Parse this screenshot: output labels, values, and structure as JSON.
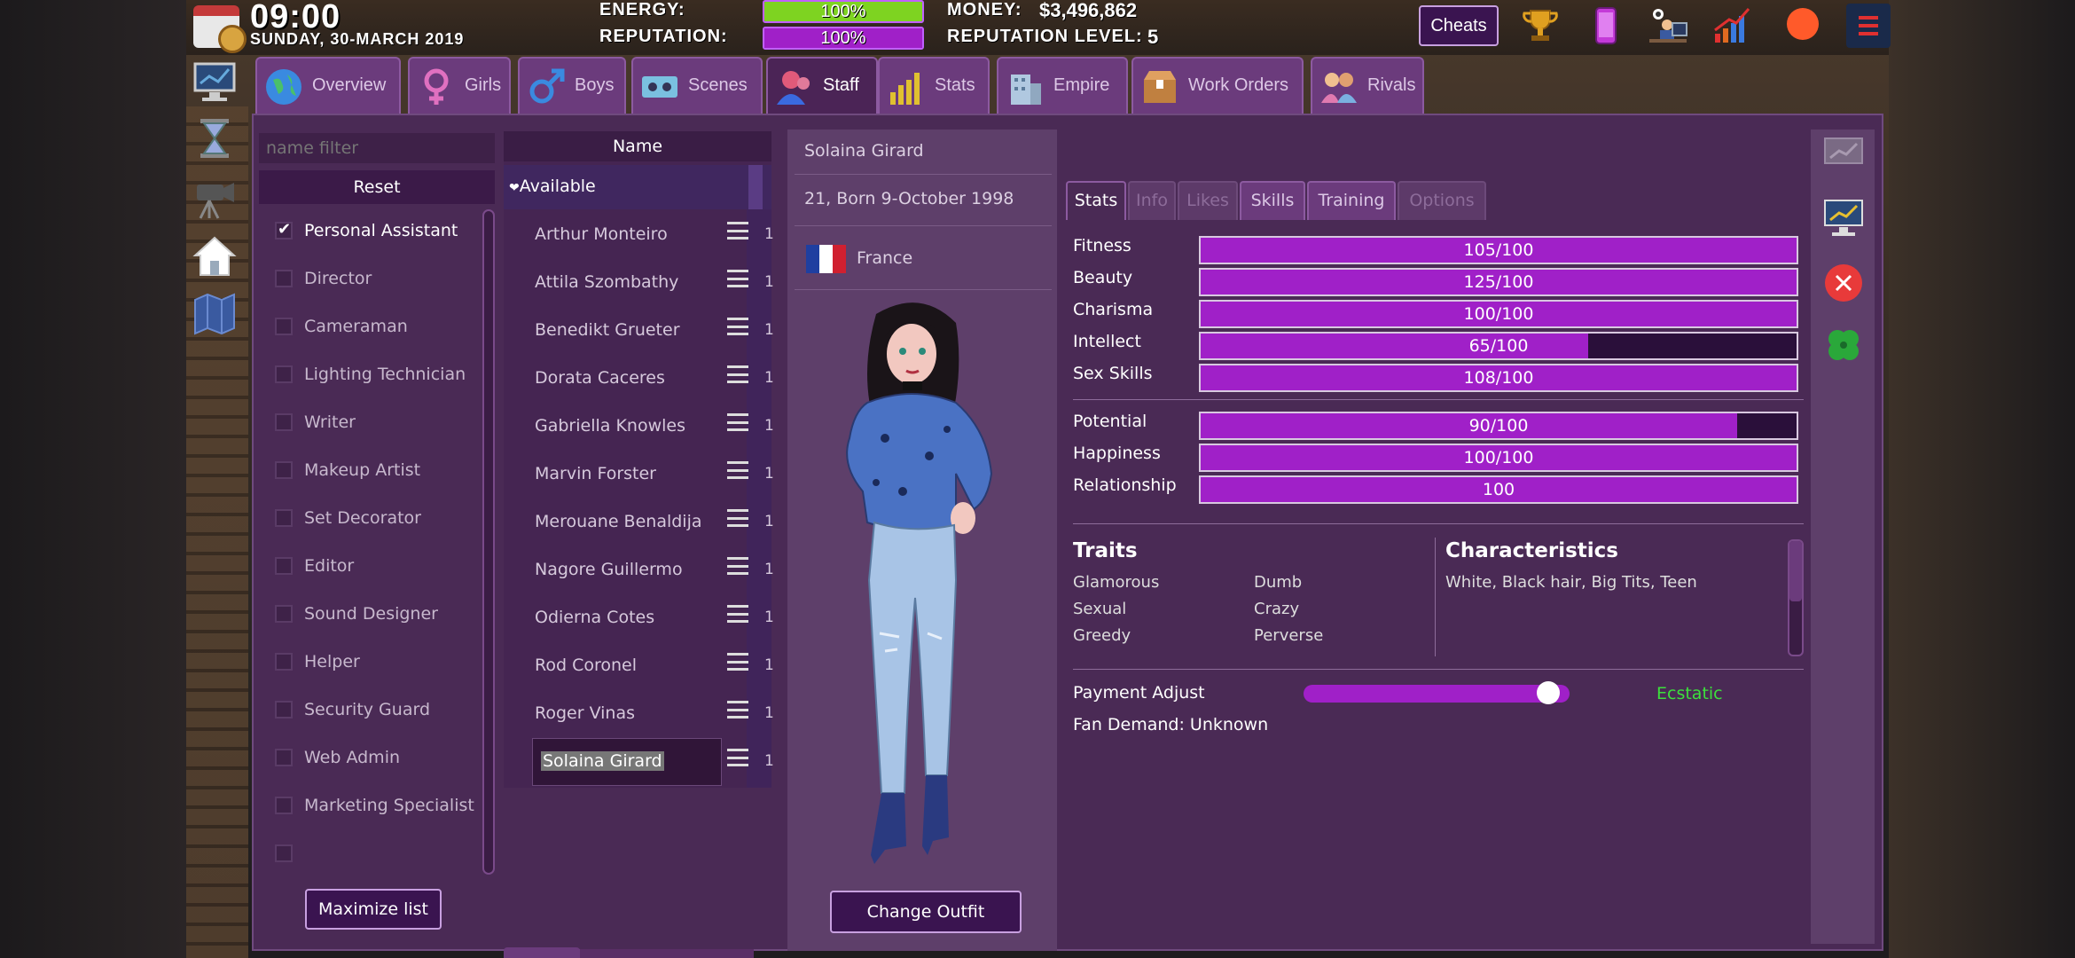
{
  "hud": {
    "time": "09:00",
    "date": "SUNDAY, 30-MARCH  2019",
    "energy_label": "ENERGY:",
    "energy_value": "100%",
    "energy_fraction": 1.0,
    "reputation_label": "REPUTATION:",
    "reputation_value": "100%",
    "money_label": "MONEY:",
    "money_value": "$3,496,862",
    "rep_level_label": "REPUTATION LEVEL:",
    "rep_level_value": "5",
    "cheats_label": "Cheats"
  },
  "tabs": [
    {
      "label": "Overview",
      "icon": "globe-icon"
    },
    {
      "label": "Girls",
      "icon": "female-icon"
    },
    {
      "label": "Boys",
      "icon": "male-icon"
    },
    {
      "label": "Scenes",
      "icon": "cassette-icon"
    },
    {
      "label": "Staff",
      "icon": "staff-icon",
      "active": true
    },
    {
      "label": "Stats",
      "icon": "bar-chart-icon"
    },
    {
      "label": "Empire",
      "icon": "building-icon"
    },
    {
      "label": "Work Orders",
      "icon": "box-icon"
    },
    {
      "label": "Rivals",
      "icon": "rivals-icon"
    }
  ],
  "filter": {
    "placeholder": "name filter",
    "reset_label": "Reset",
    "roles": [
      {
        "label": "Personal Assistant",
        "checked": true
      },
      {
        "label": "Director",
        "checked": false
      },
      {
        "label": "Cameraman",
        "checked": false
      },
      {
        "label": "Lighting Technician",
        "checked": false
      },
      {
        "label": "Writer",
        "checked": false
      },
      {
        "label": "Makeup Artist",
        "checked": false
      },
      {
        "label": "Set Decorator",
        "checked": false
      },
      {
        "label": "Editor",
        "checked": false
      },
      {
        "label": "Sound Designer",
        "checked": false
      },
      {
        "label": "Helper",
        "checked": false
      },
      {
        "label": "Security Guard",
        "checked": false
      },
      {
        "label": "Web Admin",
        "checked": false
      },
      {
        "label": "Marketing Specialist",
        "checked": false
      },
      {
        "label": "",
        "checked": false
      }
    ],
    "maximize_label": "Maximize list"
  },
  "staff_list": {
    "header": "Name",
    "group": "Available",
    "group_glyph": "❤",
    "names": [
      "Arthur Monteiro",
      "Attila Szombathy",
      "Benedikt Grueter",
      "Dorata Caceres",
      "Gabriella Knowles",
      "Marvin Forster",
      "Merouane Benaldija",
      "Nagore Guillermo",
      "Odierna Cotes",
      "Rod Coronel",
      "Roger Vinas",
      "Solaina Girard"
    ],
    "count_glyph": "1",
    "selected": "Solaina Girard"
  },
  "profile": {
    "name": "Solaina Girard",
    "born": "21, Born 9-October 1998",
    "country": "France",
    "flag_colors": [
      "#1f3fa0",
      "#ffffff",
      "#d02030"
    ],
    "change_outfit_label": "Change Outfit"
  },
  "detail_tabs": [
    {
      "label": "Stats",
      "state": "active"
    },
    {
      "label": "Info",
      "state": "disabled"
    },
    {
      "label": "Likes",
      "state": "disabled"
    },
    {
      "label": "Skills",
      "state": "enabled"
    },
    {
      "label": "Training",
      "state": "enabled"
    },
    {
      "label": "Options",
      "state": "disabled"
    }
  ],
  "stats": {
    "attributes": [
      {
        "label": "Fitness",
        "text": "105/100",
        "fraction": 1.0
      },
      {
        "label": "Beauty",
        "text": "125/100",
        "fraction": 1.0
      },
      {
        "label": "Charisma",
        "text": "100/100",
        "fraction": 1.0
      },
      {
        "label": "Intellect",
        "text": "65/100",
        "fraction": 0.65
      },
      {
        "label": "Sex Skills",
        "text": "108/100",
        "fraction": 1.0
      }
    ],
    "secondary": [
      {
        "label": "Potential",
        "text": "90/100",
        "fraction": 0.9
      },
      {
        "label": "Happiness",
        "text": "100/100",
        "fraction": 1.0
      },
      {
        "label": "Relationship",
        "text": "100",
        "fraction": 1.0
      }
    ],
    "traits_title": "Traits",
    "traits": [
      "Glamorous",
      "Dumb",
      "Sexual",
      "Crazy",
      "Greedy",
      "Perverse"
    ],
    "characteristics_title": "Characteristics",
    "characteristics": "White, Black hair, Big Tits, Teen",
    "payment_label": "Payment Adjust",
    "payment_fraction": 0.92,
    "payment_status": "Ecstatic",
    "fan_demand": "Fan Demand: Unknown"
  },
  "colors": {
    "accent_purple": "#a020c8",
    "energy_green": "#7ed321",
    "status_green": "#3ce03c"
  }
}
